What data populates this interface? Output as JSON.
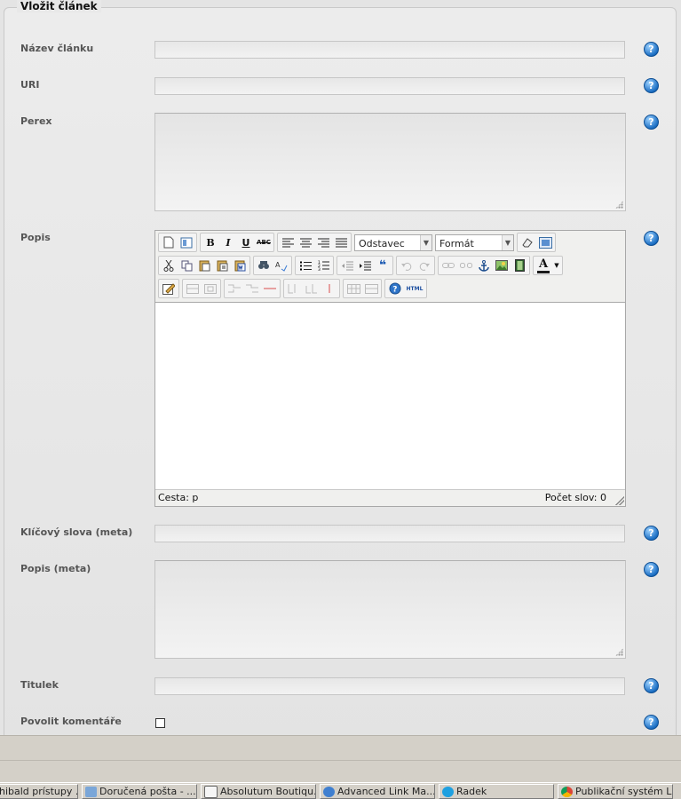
{
  "form": {
    "legend": "Vložit článek",
    "help_glyph": "?",
    "fields": {
      "nazev": {
        "label": "Název článku",
        "value": ""
      },
      "uri": {
        "label": "URI",
        "value": ""
      },
      "perex": {
        "label": "Perex",
        "value": ""
      },
      "popis": {
        "label": "Popis"
      },
      "keywords": {
        "label": "Klíčový slova (meta)",
        "value": ""
      },
      "description": {
        "label": "Popis (meta)",
        "value": ""
      },
      "titulek": {
        "label": "Titulek",
        "value": ""
      },
      "komentare": {
        "label": "Povolit komentáře",
        "checked": false
      }
    }
  },
  "editor": {
    "block_format": "Odstavec",
    "style_format": "Formát",
    "path_text": "Cesta: p",
    "word_count": "Počet slov: 0",
    "buttons": {
      "bold": "B",
      "italic": "I",
      "underline": "U",
      "strike": "ABC",
      "quote": "❝",
      "html": "HTML",
      "font_color": "A"
    }
  },
  "taskbar": [
    {
      "label": "hibald prístupy ..."
    },
    {
      "label": "Doručená pošta - ..."
    },
    {
      "label": "Absolutum Boutiqu..."
    },
    {
      "label": "Advanced Link Ma..."
    },
    {
      "label": "Radek"
    },
    {
      "label": "Publikační systém L..."
    }
  ]
}
